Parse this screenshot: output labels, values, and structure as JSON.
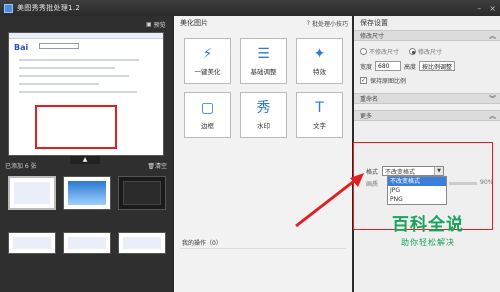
{
  "window": {
    "title": "美图秀秀批处理1.2"
  },
  "left": {
    "preview_label": "预览",
    "added_label": "已添加 6 张",
    "clear_label": "清空"
  },
  "middle": {
    "heading": "美化图片",
    "help": "批处理小技巧",
    "tools": [
      {
        "label": "一键美化",
        "icon": "magic-wand-icon",
        "glyph": "⚡"
      },
      {
        "label": "基础调整",
        "icon": "sliders-icon",
        "glyph": "☰"
      },
      {
        "label": "特效",
        "icon": "sparkle-wand-icon",
        "glyph": "✦"
      },
      {
        "label": "边框",
        "icon": "frame-icon",
        "glyph": "▢"
      },
      {
        "label": "水印",
        "icon": "watermark-icon",
        "glyph": "秀"
      },
      {
        "label": "文字",
        "icon": "text-icon",
        "glyph": "T"
      }
    ],
    "ops_label": "我的操作（0）"
  },
  "right": {
    "heading": "保存设置",
    "size_section": "修改尺寸",
    "radio_keep": "不修改尺寸",
    "radio_modify": "修改尺寸",
    "width_label": "宽度",
    "width_value": "680",
    "height_label": "高度",
    "height_value": "按比例调整",
    "keep_ratio": "保持原图比例",
    "rename_section": "重命名",
    "more_section": "更多",
    "format_label": "格式",
    "format_value": "不改变格式",
    "format_options": [
      "不改变格式",
      "JPG",
      "PNG"
    ],
    "quality_label": "画质",
    "quality_value": "90%"
  },
  "watermark": {
    "line1": "百科全说",
    "line2": "助你轻松解决"
  },
  "colors": {
    "accent": "#2d7bd6",
    "highlight": "#e02020",
    "watermark": "#19a35d"
  }
}
